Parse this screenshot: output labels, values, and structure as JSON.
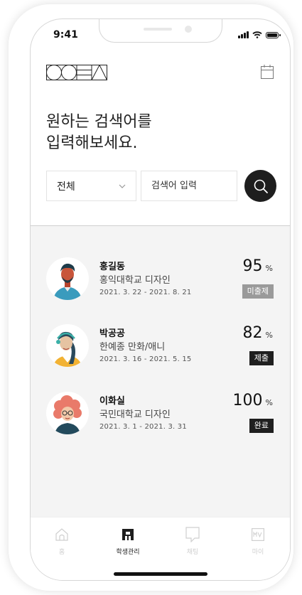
{
  "status_bar": {
    "time": "9:41"
  },
  "header": {
    "logo_icon": "brand-logo",
    "calendar_icon": "calendar-icon"
  },
  "headline": {
    "line1": "원하는 검색어를",
    "line2": "입력해보세요."
  },
  "search": {
    "category": "전체",
    "placeholder": "검색어 입력",
    "button_icon": "search-icon"
  },
  "students": [
    {
      "name": "홍길동",
      "school": "홍익대학교 디자인",
      "period": "2021. 3. 22 - 2021. 8. 21",
      "score": "95",
      "unit": "%",
      "status": "미출제",
      "status_color": "#9a9a9a"
    },
    {
      "name": "박공공",
      "school": "한예종 만화/애니",
      "period": "2021. 3. 16 - 2021. 5. 15",
      "score": "82",
      "unit": "%",
      "status": "제출",
      "status_color": "#1f1f1f"
    },
    {
      "name": "이화실",
      "school": "국민대학교 디자인",
      "period": "2021. 3. 1 - 2021. 3. 31",
      "score": "100",
      "unit": "%",
      "status": "완료",
      "status_color": "#1f1f1f"
    }
  ],
  "tabbar": {
    "items": [
      {
        "label": "홈",
        "icon": "home-icon"
      },
      {
        "label": "학생관리",
        "icon": "student-management-icon"
      },
      {
        "label": "채팅",
        "icon": "chat-icon"
      },
      {
        "label": "마이",
        "icon": "my-page-icon"
      }
    ],
    "active_index": 1
  }
}
